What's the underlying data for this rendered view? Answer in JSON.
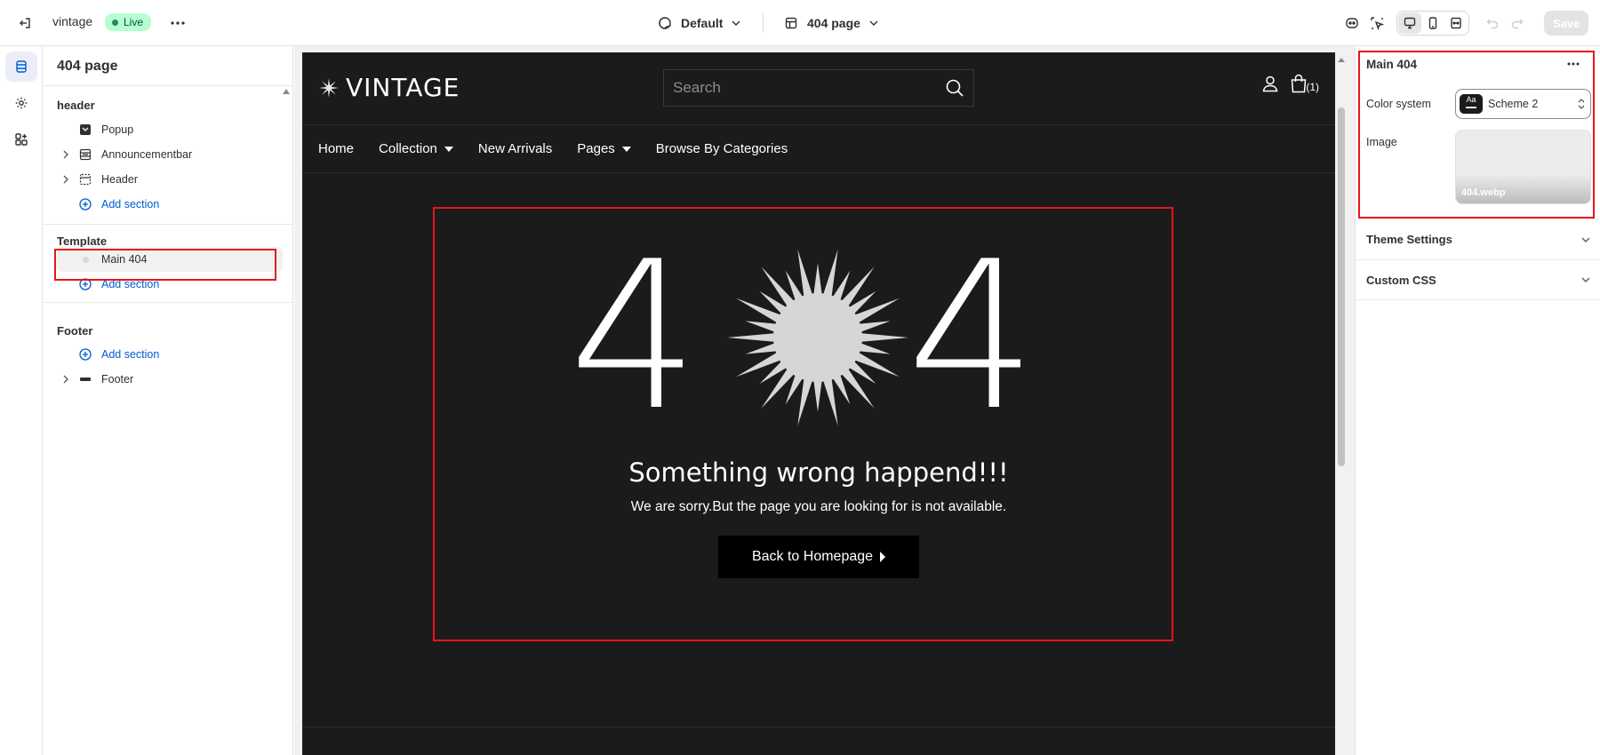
{
  "topbar": {
    "store_name": "vintage",
    "live_badge": "Live",
    "theme_label": "Default",
    "page_label": "404 page",
    "save_label": "Save"
  },
  "sidebar": {
    "title": "404 page",
    "header_group": {
      "label": "header",
      "items": [
        {
          "label": "Popup"
        },
        {
          "label": "Announcementbar"
        },
        {
          "label": "Header"
        }
      ],
      "add_label": "Add section"
    },
    "template_group": {
      "label": "Template",
      "items": [
        {
          "label": "Main 404"
        }
      ],
      "add_label": "Add section"
    },
    "footer_group": {
      "label": "Footer",
      "add_label": "Add section",
      "items": [
        {
          "label": "Footer"
        }
      ]
    }
  },
  "preview": {
    "logo_text": "VINTAGE",
    "search_placeholder": "Search",
    "cart_count": "(1)",
    "nav": [
      {
        "label": "Home",
        "dropdown": false
      },
      {
        "label": "Collection",
        "dropdown": true
      },
      {
        "label": "New Arrivals",
        "dropdown": false
      },
      {
        "label": "Pages",
        "dropdown": true
      },
      {
        "label": "Browse By Categories",
        "dropdown": false
      }
    ],
    "error": {
      "digit_left": "4",
      "digit_right": "4",
      "title": "Something wrong happend!!!",
      "subtitle": "We are sorry.But the page you are looking for is not available.",
      "button_label": "Back to Homepage"
    }
  },
  "settings": {
    "title": "Main 404",
    "color_system_label": "Color system",
    "color_system_value": "Scheme 2",
    "swatch_text": "Aa",
    "image_label": "Image",
    "image_filename": "404.webp",
    "accordions": [
      {
        "label": "Theme Settings"
      },
      {
        "label": "Custom CSS"
      }
    ]
  },
  "colors": {
    "highlight": "#e8141b",
    "link": "#005bd3",
    "preview_bg": "#1b1b1b",
    "live_badge_bg": "#b4fed2"
  }
}
